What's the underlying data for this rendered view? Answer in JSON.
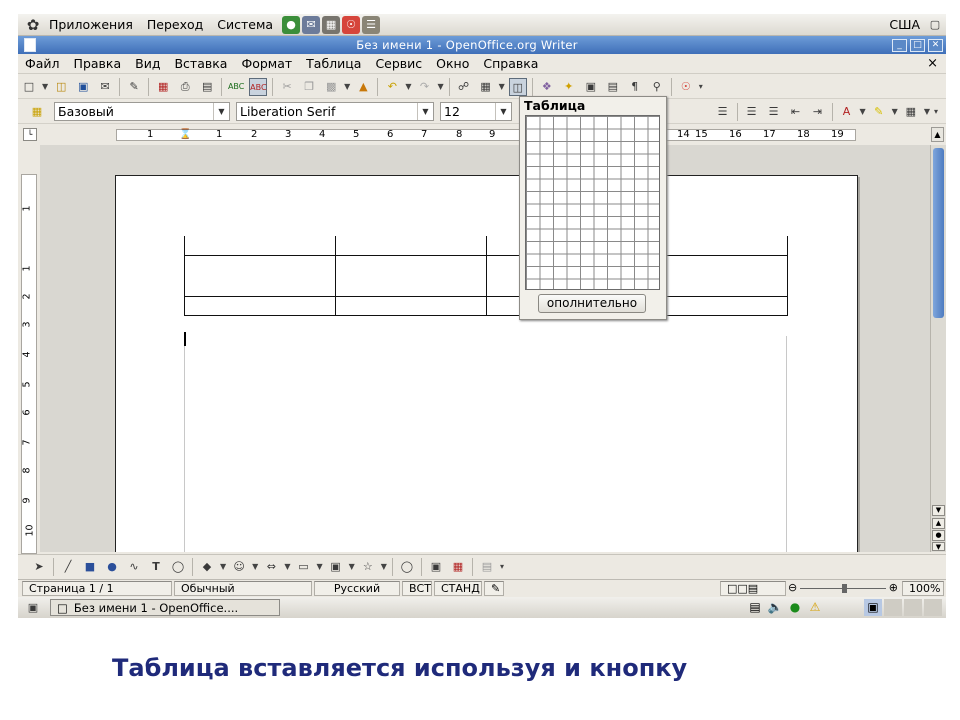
{
  "gnome_panel": {
    "menus": [
      "Приложения",
      "Переход",
      "Система"
    ],
    "keyboard_layout": "США"
  },
  "window": {
    "title": "Без имени 1 - OpenOffice.org Writer"
  },
  "menubar": {
    "items": [
      "Файл",
      "Правка",
      "Вид",
      "Вставка",
      "Формат",
      "Таблица",
      "Сервис",
      "Окно",
      "Справка"
    ],
    "close": "×"
  },
  "format_toolbar": {
    "style": "Базовый",
    "font": "Liberation Serif",
    "size": "12"
  },
  "ruler": {
    "marks": [
      "1",
      "1",
      "2",
      "3",
      "4",
      "5",
      "6",
      "7",
      "8",
      "9",
      "14",
      "15",
      "16",
      "17",
      "18",
      "19"
    ],
    "vertical_marks": [
      "1",
      "1",
      "2",
      "3",
      "4",
      "5",
      "6",
      "7",
      "8",
      "9",
      "10"
    ]
  },
  "table_popup": {
    "title": "Таблица",
    "more_button": "ополнительно"
  },
  "statusbar": {
    "page": "Страница  1 / 1",
    "style": "Обычный",
    "language": "Русский",
    "insert_mode": "ВСТ",
    "selection_mode": "СТАНД",
    "zoom": "100%"
  },
  "bottom_panel": {
    "task": "Без имени 1 - OpenOffice...."
  },
  "caption": "Таблица вставляется используя и кнопку",
  "colors": {
    "titlebar": "#4a7cc3",
    "caption": "#1f2a7a",
    "scrollbar": "#5d8ad0"
  }
}
